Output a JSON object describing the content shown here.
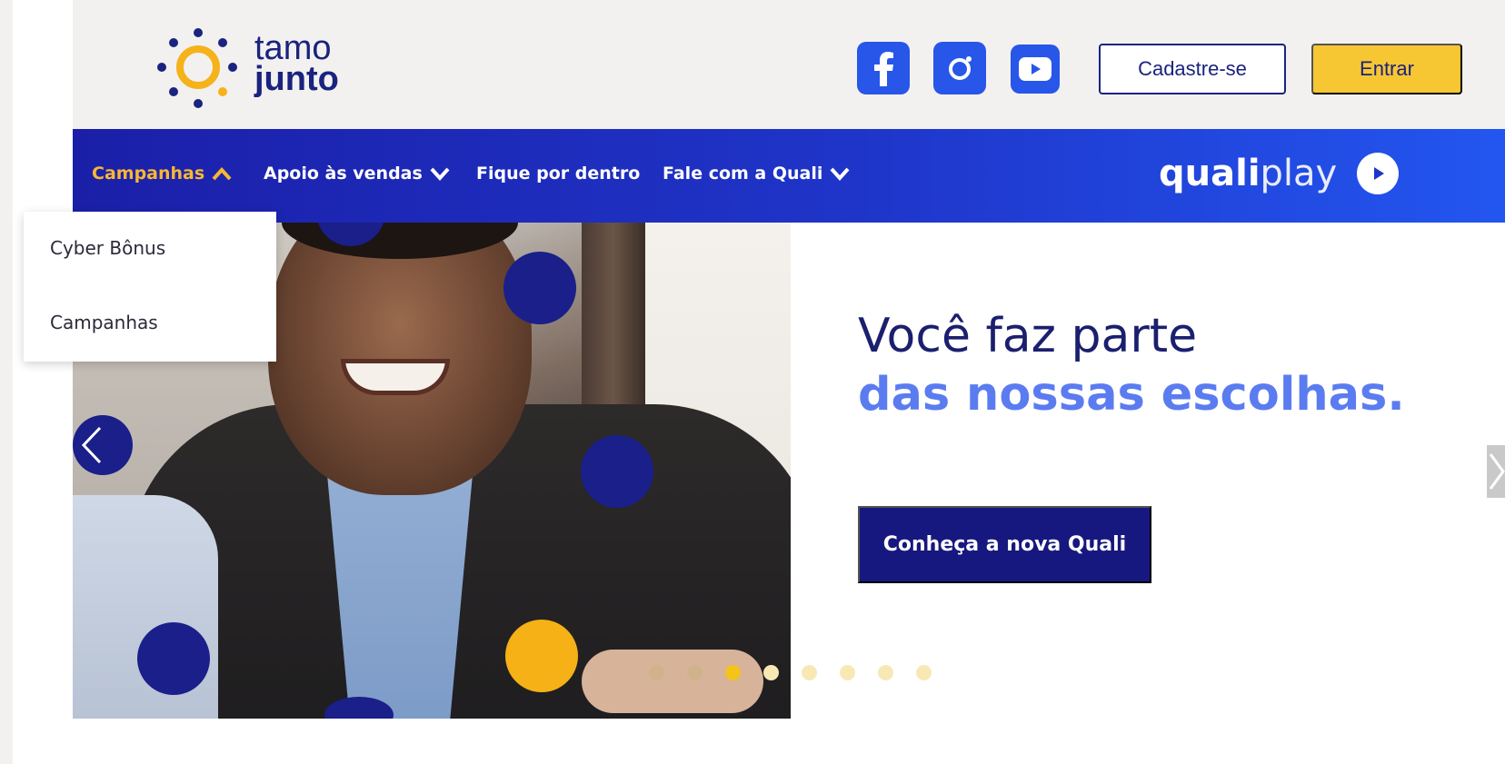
{
  "brand": {
    "logo_word1": "tamo",
    "logo_word2": "junto",
    "logo_icon": "sun-logo-icon",
    "colors": {
      "navy": "#1a237e",
      "yellow": "#f7c633",
      "blue": "#2756e8"
    }
  },
  "header": {
    "social": [
      {
        "name": "facebook-icon"
      },
      {
        "name": "instagram-icon"
      },
      {
        "name": "youtube-icon"
      }
    ],
    "register_label": "Cadastre-se",
    "login_label": "Entrar"
  },
  "nav": {
    "items": [
      {
        "label": "Campanhas",
        "active": true,
        "chevron": "chevron-up-icon"
      },
      {
        "label": "Apoio às vendas",
        "chevron": "chevron-down-icon"
      },
      {
        "label": "Fique por dentro"
      },
      {
        "label": "Fale com a Quali",
        "chevron": "chevron-down-icon"
      }
    ],
    "qualiplay_bold": "quali",
    "qualiplay_light": "play",
    "qualiplay_icon": "play-icon"
  },
  "dropdown": {
    "items": [
      {
        "label": "Cyber Bônus"
      },
      {
        "label": "Campanhas"
      }
    ]
  },
  "hero": {
    "title_line1": "Você faz parte",
    "title_line2": "das nossas escolhas.",
    "cta_label": "Conheça a nova Quali",
    "carousel": {
      "total_dots": 8,
      "active_index": 2
    }
  }
}
